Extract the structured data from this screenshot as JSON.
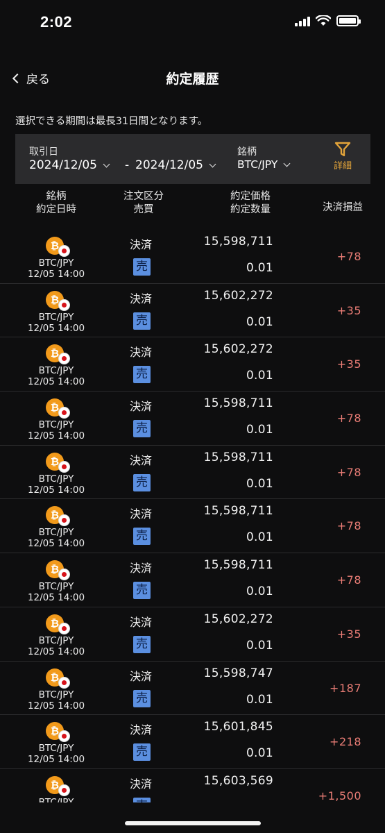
{
  "status": {
    "time": "2:02"
  },
  "nav": {
    "back_label": "戻る",
    "title": "約定履歴"
  },
  "notice": "選択できる期間は最長31日間となります。",
  "filter": {
    "date_label": "取引日",
    "date_from": "2024/12/05",
    "date_separator": "-",
    "date_to": "2024/12/05",
    "symbol_label": "銘柄",
    "symbol_value": "BTC/JPY",
    "detail_label": "詳細",
    "accent_color": "#e3a43a"
  },
  "columns": {
    "col1_line1": "銘柄",
    "col1_line2": "約定日時",
    "col2_line1": "注文区分",
    "col2_line2": "売買",
    "col3_line1": "約定価格",
    "col3_line2": "約定数量",
    "col4": "決済損益"
  },
  "rows": [
    {
      "pair": "BTC/JPY",
      "time": "12/05 14:00",
      "type": "決済",
      "side": "売",
      "price": "15,598,711",
      "qty": "0.01",
      "pnl": "+78"
    },
    {
      "pair": "BTC/JPY",
      "time": "12/05 14:00",
      "type": "決済",
      "side": "売",
      "price": "15,602,272",
      "qty": "0.01",
      "pnl": "+35"
    },
    {
      "pair": "BTC/JPY",
      "time": "12/05 14:00",
      "type": "決済",
      "side": "売",
      "price": "15,602,272",
      "qty": "0.01",
      "pnl": "+35"
    },
    {
      "pair": "BTC/JPY",
      "time": "12/05 14:00",
      "type": "決済",
      "side": "売",
      "price": "15,598,711",
      "qty": "0.01",
      "pnl": "+78"
    },
    {
      "pair": "BTC/JPY",
      "time": "12/05 14:00",
      "type": "決済",
      "side": "売",
      "price": "15,598,711",
      "qty": "0.01",
      "pnl": "+78"
    },
    {
      "pair": "BTC/JPY",
      "time": "12/05 14:00",
      "type": "決済",
      "side": "売",
      "price": "15,598,711",
      "qty": "0.01",
      "pnl": "+78"
    },
    {
      "pair": "BTC/JPY",
      "time": "12/05 14:00",
      "type": "決済",
      "side": "売",
      "price": "15,598,711",
      "qty": "0.01",
      "pnl": "+78"
    },
    {
      "pair": "BTC/JPY",
      "time": "12/05 14:00",
      "type": "決済",
      "side": "売",
      "price": "15,602,272",
      "qty": "0.01",
      "pnl": "+35"
    },
    {
      "pair": "BTC/JPY",
      "time": "12/05 14:00",
      "type": "決済",
      "side": "売",
      "price": "15,598,747",
      "qty": "0.01",
      "pnl": "+187"
    },
    {
      "pair": "BTC/JPY",
      "time": "12/05 14:00",
      "type": "決済",
      "side": "売",
      "price": "15,601,845",
      "qty": "0.01",
      "pnl": "+218"
    },
    {
      "pair": "BTC/JPY",
      "time": "",
      "type": "決済",
      "side": "売",
      "price": "15,603,569",
      "qty": "",
      "pnl": "+1,500"
    }
  ],
  "colors": {
    "sell_badge": "#5b8fe0",
    "profit": "#ea7d76",
    "btc_icon": "#f29a1b"
  },
  "icons": {
    "coin": "bitcoin-icon",
    "quote": "japan-flag-icon",
    "filter": "funnel-icon"
  }
}
